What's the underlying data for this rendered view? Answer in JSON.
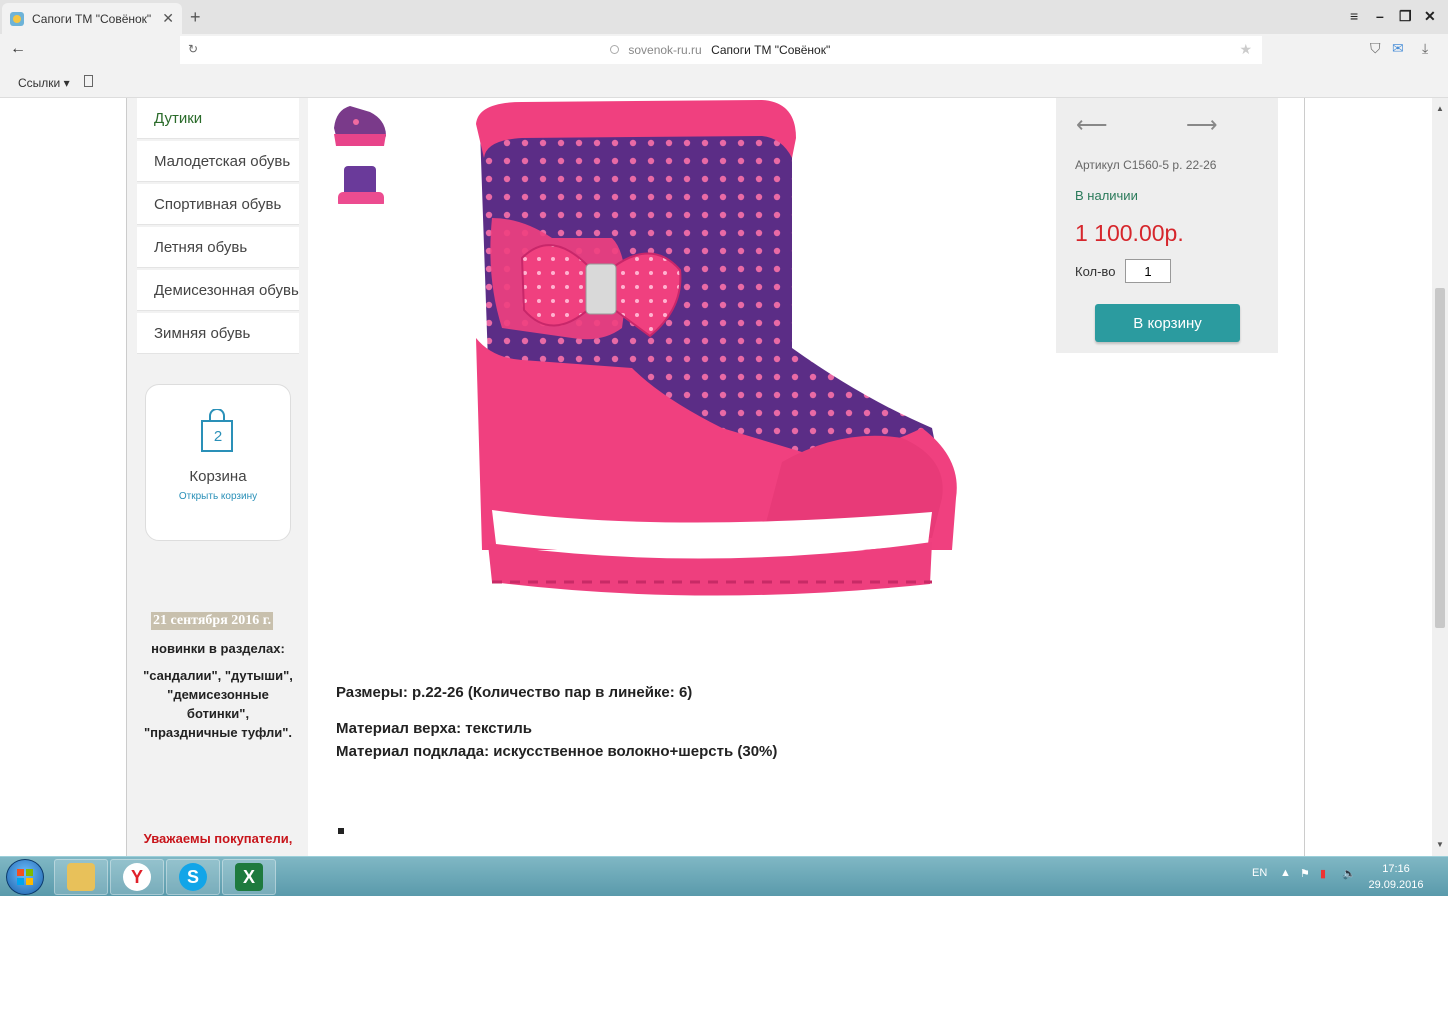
{
  "browser": {
    "tab_title": "Сапоги ТМ \"Совёнок\"",
    "tab_close": "✕",
    "new_tab": "+",
    "domain": "sovenok-ru.ru",
    "page_title": "Сапоги ТМ \"Совёнок\"",
    "bookmarks_label": "Ссылки"
  },
  "sidebar": {
    "menu": [
      {
        "label": "Дутики"
      },
      {
        "label": "Малодетская обувь"
      },
      {
        "label": "Спортивная обувь"
      },
      {
        "label": "Летняя обувь"
      },
      {
        "label": "Демисезонная обувь"
      },
      {
        "label": "Зимняя обувь"
      }
    ],
    "cart": {
      "count": "2",
      "title": "Корзина",
      "link": "Открыть корзину"
    },
    "news": {
      "date": "21 сентября 2016 г.",
      "line1": "новинки в разделах:",
      "line2": "\"сандалии\", \"дутыши\",",
      "line3": "\"демисезонные",
      "line4": "ботинки\",",
      "line5": "\"праздничные туфли\".",
      "notice": "Уважаемы покупатели,"
    }
  },
  "product": {
    "article": "Артикул С1560-5 р. 22-26",
    "availability": "В наличии",
    "price": "1 100.00р.",
    "qty_label": "Кол-во",
    "qty_value": "1",
    "add_to_cart": "В корзину",
    "sizes": "Размеры: р.22-26 (Количество пар в линейке: 6)",
    "material_top": "Материал верха: текстиль",
    "material_lining": "Материал подклада: искусственное волокно+шерсть (30%)"
  },
  "taskbar": {
    "apps": [
      {
        "name": "file-explorer",
        "glyph": ""
      },
      {
        "name": "yandex-browser",
        "glyph": "Y"
      },
      {
        "name": "skype",
        "glyph": "S"
      },
      {
        "name": "excel",
        "glyph": "X"
      }
    ],
    "lang": "EN",
    "time": "17:16",
    "date": "29.09.2016"
  },
  "colors": {
    "price": "#d6262c",
    "stock": "#2a7a5a",
    "button": "#2b9b9f",
    "boot_pink": "#f0407f",
    "boot_purple": "#5b2d86"
  }
}
